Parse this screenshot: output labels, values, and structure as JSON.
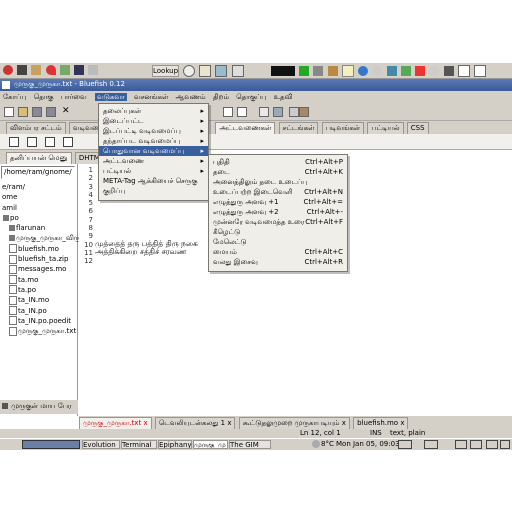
{
  "top_panel": {
    "lookup_label": "Lookup"
  },
  "title_bar": {
    "title": "முருகு_முருகா.txt - Bluefish 0.12"
  },
  "menubar": [
    "கோப்பு",
    "தொகு",
    "பார்வை",
    "ஆவணம்",
    "வடுகவா",
    "வசனங்கள்",
    "ஆவணம்",
    "திறம்",
    "அமைப்புகள்",
    "தொகுப்பு",
    "உதவி"
  ],
  "toolbar": {
    "close_label": "✕"
  },
  "tabs_row1": [
    "விளம்பர சட்டம்",
    "வடிவமை",
    "அட்டவணைகள்",
    "சட்டங்கள்",
    "படிவங்கள்",
    "பட்டியல்",
    "CSS"
  ],
  "left_tabs": [
    "தனிப்பயன் மெனு",
    "DHTML"
  ],
  "file_panel": {
    "path": "/home/ram/gnome/",
    "tree": [
      "e/ram/",
      "ome",
      "amil",
      "po",
      "flarunan",
      "முருகு_முருகா_விருப்பம்",
      "bluefish.mo",
      "bluefish_ta.zip",
      "messages.mo",
      "ta.mo",
      "ta.po",
      "ta_IN.mo",
      "ta_IN.po",
      "ta_IN.po.poedit",
      "முருகு_முருகா.txt"
    ],
    "bottom_label": "முருகுள் மாய பேர"
  },
  "editor": {
    "line_numbers": [
      "1",
      "2",
      "3",
      "4",
      "5",
      "6",
      "7",
      "8",
      "9",
      "10",
      "11",
      "12"
    ],
    "lines": [
      "முத்தைத் தரு பத்தித் திரு நகை",
      "அத்திக்கிறை சத்திச் சரவண"
    ]
  },
  "main_menu": {
    "items": [
      "தலைப்புகள்",
      "இடைப்பட்ட",
      "இடப்பட்டி வடிவமைப்பு",
      "தந்தாப்பட வடிவமைப்பு",
      "பொதுவான வடிவமைப்பு",
      "அட்டவணை",
      "பட்டியல்",
      "META-Tag ஆக்கியைச் செருகு",
      "குறிப்பு"
    ]
  },
  "submenu": {
    "items": [
      {
        "label": "புதிதி",
        "shortcut": "Ctrl+Alt+P"
      },
      {
        "label": "தடை",
        "shortcut": "Ctrl+Alt+K"
      },
      {
        "label": "அனைத்திலும் தடை உடைப்பு",
        "shortcut": ""
      },
      {
        "label": "உடைப்பற்ற இடைவெளி",
        "shortcut": "Ctrl+Alt+N"
      },
      {
        "label": "எழுத்துரு அளவு +1",
        "shortcut": "Ctrl+Alt+="
      },
      {
        "label": "எழுத்துரு அளவு +2",
        "shortcut": "Ctrl+Alt+-"
      },
      {
        "label": "முன்னரே வடிவமைத்த உரை",
        "shortcut": "Ctrl+Alt+F"
      },
      {
        "label": "கீழெட்டு",
        "shortcut": ""
      },
      {
        "label": "மேலெட்டு",
        "shortcut": ""
      },
      {
        "label": "மையம்",
        "shortcut": "Ctrl+Alt+C"
      },
      {
        "label": "வலது இசைவு",
        "shortcut": "Ctrl+Alt+R"
      }
    ]
  },
  "doc_tabs": [
    "முருகு_முருகா.txt",
    "டெவலியுடன்கலது 1",
    "கூட்டுதலுமுறை முருகாபடியும்",
    "bluefish.mo"
  ],
  "status_bar": {
    "left": "Ln 12, col 1",
    "mode": "INS",
    "type": "text, plain"
  },
  "taskbar": {
    "items": [
      "Evolution",
      "Terminal",
      "Epiphany",
      "முருகு_மு",
      "The GIM"
    ],
    "weather": "8°C",
    "clock": "Mon Jan 05, 09:03"
  }
}
